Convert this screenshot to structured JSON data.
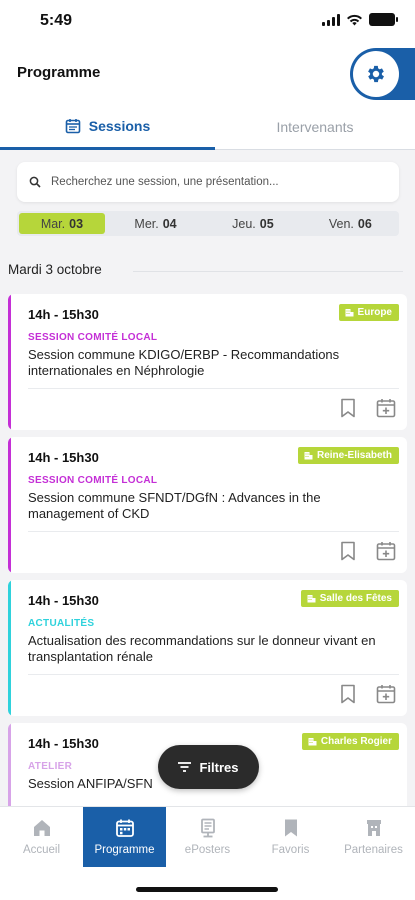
{
  "status": {
    "time": "5:49"
  },
  "header": {
    "title": "Programme"
  },
  "tabs": {
    "sessions": "Sessions",
    "speakers": "Intervenants"
  },
  "search": {
    "placeholder": "Recherchez une session, une présentation..."
  },
  "days": [
    {
      "day": "Mar.",
      "num": "03",
      "active": true
    },
    {
      "day": "Mer.",
      "num": "04"
    },
    {
      "day": "Jeu.",
      "num": "05"
    },
    {
      "day": "Ven.",
      "num": "06"
    }
  ],
  "section": {
    "label": "Mardi 3 octobre"
  },
  "sessions": [
    {
      "time": "14h - 15h30",
      "room": "Europe",
      "category": "SESSION COMITÉ LOCAL",
      "title": "Session commune KDIGO/ERBP - Recommandations internationales en Néphrologie",
      "color": "#c42fd6"
    },
    {
      "time": "14h - 15h30",
      "room": "Reine-Elisabeth",
      "category": "SESSION COMITÉ LOCAL",
      "title": "Session commune SFNDT/DGfN : Advances in the management of CKD",
      "color": "#c42fd6"
    },
    {
      "time": "14h - 15h30",
      "room": "Salle des Fêtes",
      "category": "ACTUALITÉS",
      "title": "Actualisation des recommandations sur le donneur vivant en transplantation rénale",
      "color": "#2fd2dc"
    },
    {
      "time": "14h - 15h30",
      "room": "Charles Rogier",
      "category": "ATELIER",
      "title": "Session ANFIPA/SFN",
      "color": "#d7a3e8"
    }
  ],
  "filters": {
    "label": "Filtres"
  },
  "nav": [
    {
      "label": "Accueil",
      "icon": "home-icon"
    },
    {
      "label": "Programme",
      "icon": "calendar-icon",
      "active": true
    },
    {
      "label": "ePosters",
      "icon": "poster-icon"
    },
    {
      "label": "Favoris",
      "icon": "bookmark-icon"
    },
    {
      "label": "Partenaires",
      "icon": "partners-icon"
    }
  ],
  "colors": {
    "accent": "#1a5fa8",
    "room_badge": "#b6d63a",
    "category_purple": "#c42fd6",
    "category_cyan": "#2fd2dc"
  }
}
